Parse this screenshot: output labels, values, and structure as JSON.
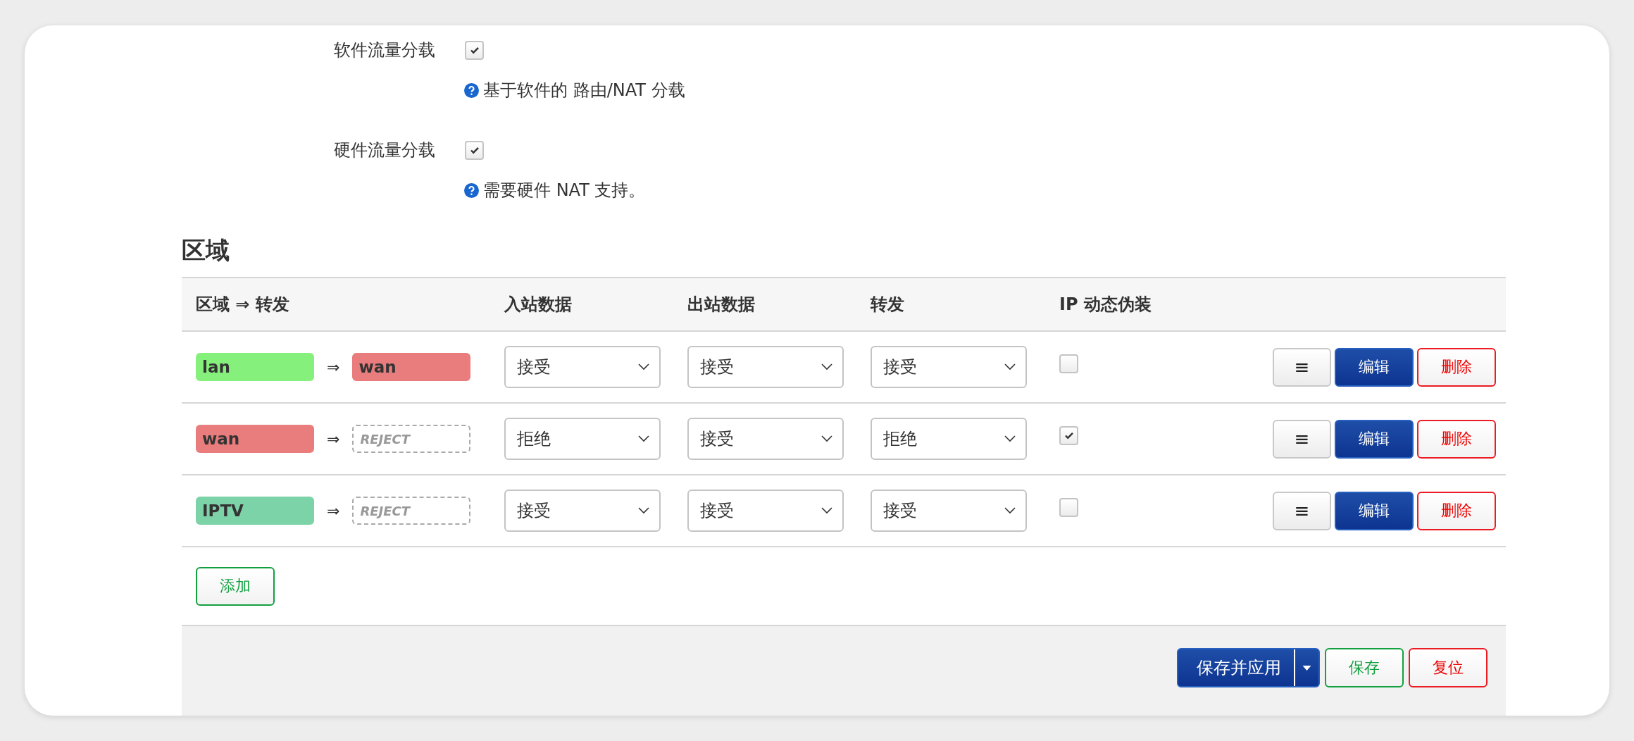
{
  "offload_settings": [
    {
      "label": "软件流量分载",
      "checked": true,
      "help": "基于软件的 路由/NAT 分载"
    },
    {
      "label": "硬件流量分载",
      "checked": true,
      "help": "需要硬件 NAT 支持。"
    }
  ],
  "zones": {
    "heading": "区域",
    "columns": [
      "区域 ⇒ 转发",
      "入站数据",
      "出站数据",
      "转发",
      "IP 动态伪装"
    ],
    "rows": [
      {
        "from": {
          "name": "lan",
          "color": "#85f07c"
        },
        "arrow": "⇒",
        "to": {
          "kind": "zone",
          "name": "wan",
          "color": "#e97c7c"
        },
        "input": "接受",
        "output": "接受",
        "forward": "接受",
        "masquerade": false,
        "buttons": [
          {
            "kind": "menu",
            "label": "≡"
          },
          {
            "kind": "primary",
            "label": "编辑"
          },
          {
            "kind": "danger",
            "label": "删除"
          }
        ]
      },
      {
        "from": {
          "name": "wan",
          "color": "#e97c7c"
        },
        "arrow": "⇒",
        "to": {
          "kind": "reject",
          "name": "REJECT"
        },
        "input": "拒绝",
        "output": "接受",
        "forward": "拒绝",
        "masquerade": true,
        "buttons": [
          {
            "kind": "menu",
            "label": "≡"
          },
          {
            "kind": "primary",
            "label": "编辑"
          },
          {
            "kind": "danger",
            "label": "删除"
          }
        ]
      },
      {
        "from": {
          "name": "IPTV",
          "color": "#7dd3a8"
        },
        "arrow": "⇒",
        "to": {
          "kind": "reject",
          "name": "REJECT"
        },
        "input": "接受",
        "output": "接受",
        "forward": "接受",
        "masquerade": false,
        "buttons": [
          {
            "kind": "menu",
            "label": "≡"
          },
          {
            "kind": "primary",
            "label": "编辑"
          },
          {
            "kind": "danger",
            "label": "删除"
          }
        ]
      }
    ],
    "add_button": "添加"
  },
  "footer": {
    "buttons": [
      {
        "kind": "split",
        "label": "保存并应用"
      },
      {
        "kind": "positive",
        "label": "保存"
      },
      {
        "kind": "danger",
        "label": "复位"
      }
    ]
  }
}
